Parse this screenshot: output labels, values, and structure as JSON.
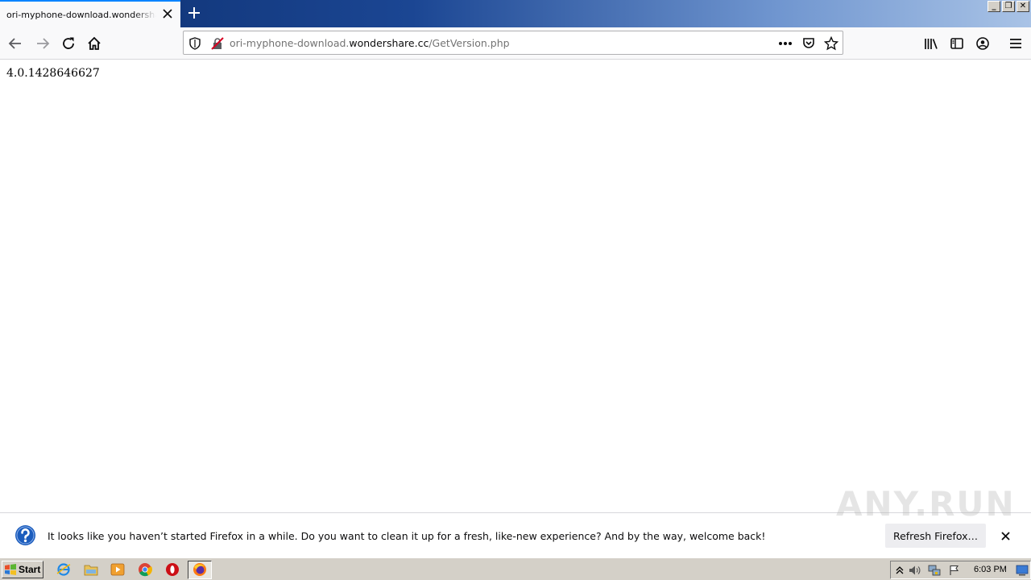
{
  "browser": {
    "tab": {
      "title": "ori-myphone-download.wondershare.cc/GetVersion.php"
    },
    "url": {
      "host_prefix": "ori-myphone-download.",
      "host": "wondershare.cc",
      "path": "/GetVersion.php"
    },
    "window_buttons": {
      "minimize": "_",
      "restore": "❐",
      "close": "✕"
    }
  },
  "page": {
    "body_text": "4.0.1428646627"
  },
  "notification": {
    "message": "It looks like you haven’t started Firefox in a while. Do you want to clean it up for a fresh, like-new experience? And by the way, welcome back!",
    "button_label": "Refresh Firefox…"
  },
  "watermark": "ANY.RUN",
  "taskbar": {
    "start_label": "Start",
    "clock": "6:03 PM",
    "apps": [
      "internet-explorer",
      "file-explorer",
      "media-player",
      "chrome",
      "opera",
      "firefox"
    ]
  },
  "colors": {
    "accent": "#0a84ff",
    "titlebar_start": "#0d2f6e",
    "titlebar_end": "#a9c3e6",
    "info_icon": "#1c5dbd"
  }
}
